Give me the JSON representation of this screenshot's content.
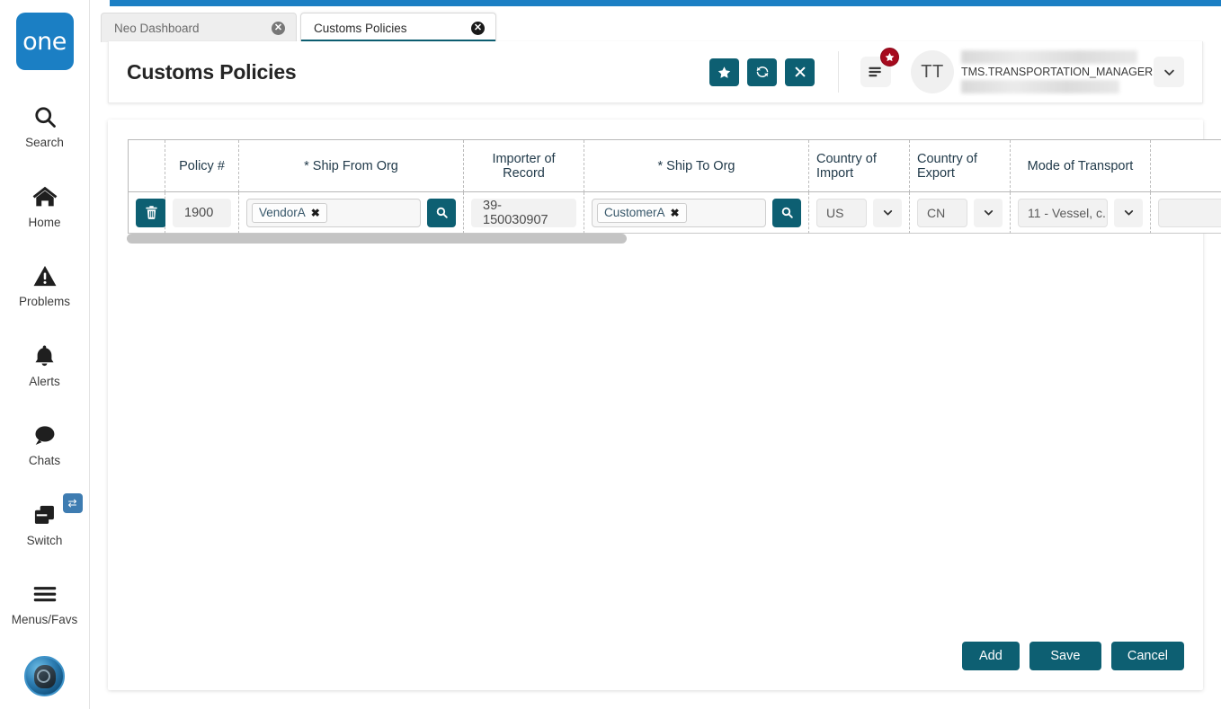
{
  "brand": {
    "logo_text": "one",
    "logo_color": "#1b7fc4"
  },
  "theme": {
    "accent": "#0d5f72",
    "top_bar": "#1b7fc4",
    "badge_red": "#a60a1e"
  },
  "sidebar": {
    "items": [
      {
        "label": "Search",
        "icon": "search-icon"
      },
      {
        "label": "Home",
        "icon": "home-icon"
      },
      {
        "label": "Problems",
        "icon": "warning-triangle-icon"
      },
      {
        "label": "Alerts",
        "icon": "bell-icon"
      },
      {
        "label": "Chats",
        "icon": "chat-bubble-icon"
      },
      {
        "label": "Switch",
        "icon": "windows-stack-icon",
        "badge_icon": "swap-arrows-icon"
      },
      {
        "label": "Menus/Favs",
        "icon": "hamburger-icon"
      }
    ],
    "assistant_icon": "ai-assistant-orb-icon"
  },
  "tabs": [
    {
      "label": "Neo Dashboard",
      "active": false,
      "close_icon": "close-circle-icon"
    },
    {
      "label": "Customs Policies",
      "active": true,
      "close_icon": "close-circle-icon"
    }
  ],
  "header": {
    "title": "Customs Policies",
    "actions": [
      {
        "name": "favorite-button",
        "icon": "star-icon"
      },
      {
        "name": "refresh-button",
        "icon": "refresh-icon"
      },
      {
        "name": "close-button",
        "icon": "x-icon"
      }
    ],
    "menu_button": {
      "icon": "list-menu-icon",
      "badge_icon": "star-icon"
    },
    "avatar_initials": "TT",
    "user_name": "TMS.TRANSPORTATION_MANAGER",
    "caret_icon": "chevron-down-icon"
  },
  "grid": {
    "columns": [
      {
        "key": "actions",
        "label": "",
        "align": "center"
      },
      {
        "key": "policy_no",
        "label": "Policy #",
        "align": "center"
      },
      {
        "key": "ship_from_org",
        "label": "* Ship From Org",
        "align": "center"
      },
      {
        "key": "importer_of_record",
        "label": "Importer of Record",
        "align": "center"
      },
      {
        "key": "ship_to_org",
        "label": "* Ship To Org",
        "align": "center"
      },
      {
        "key": "country_of_import",
        "label": "Country of Import",
        "align": "left"
      },
      {
        "key": "country_of_export",
        "label": "Country of Export",
        "align": "left"
      },
      {
        "key": "mode_of_transport",
        "label": "Mode of Transport",
        "align": "center"
      },
      {
        "key": "extra",
        "label": "",
        "align": "center"
      }
    ],
    "rows": [
      {
        "delete_icon": "trash-icon",
        "policy_no": "1900",
        "ship_from_org": {
          "token": "VendorA",
          "token_remove_icon": "x-icon",
          "search_icon": "search-icon"
        },
        "importer_of_record": "39-150030907",
        "ship_to_org": {
          "token": "CustomerA",
          "token_remove_icon": "x-icon",
          "search_icon": "search-icon"
        },
        "country_of_import": "US",
        "country_of_export": "CN",
        "mode_of_transport": "11 - Vessel, c...",
        "extra": ""
      }
    ],
    "scrollbar": {
      "name": "horizontal-scrollbar",
      "thumb_name": "horizontal-scrollbar-thumb"
    }
  },
  "footer": {
    "add_label": "Add",
    "save_label": "Save",
    "cancel_label": "Cancel"
  }
}
